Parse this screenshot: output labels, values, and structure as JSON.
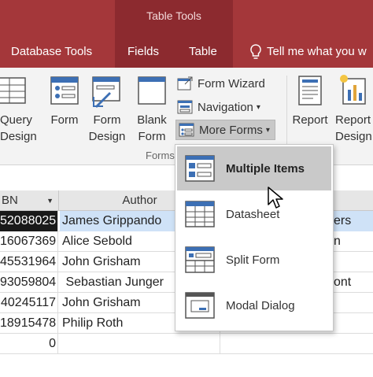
{
  "header": {
    "context_title": "Table Tools",
    "tabs": [
      {
        "label": "Database Tools"
      },
      {
        "label": "Fields"
      },
      {
        "label": "Table"
      }
    ],
    "tell_me": "Tell me what you w"
  },
  "ribbon": {
    "query_design": "Query\nDesign",
    "form": "Form",
    "form_design": "Form\nDesign",
    "blank_form": "Blank\nForm",
    "form_wizard": "Form Wizard",
    "navigation": "Navigation",
    "more_forms": "More Forms",
    "forms_group": "Forms",
    "report": "Report",
    "report_design": "Report\nDesign"
  },
  "table": {
    "columns": [
      {
        "label": "BN"
      },
      {
        "label": "Author"
      }
    ],
    "rows": [
      {
        "isbn": "52088025",
        "author": "James Grippando",
        "extra": "ers"
      },
      {
        "isbn": "16067369",
        "author": "Alice Sebold",
        "extra": "n"
      },
      {
        "isbn": "45531964",
        "author": "John Grisham",
        "extra": ""
      },
      {
        "isbn": "93059804",
        "author": " Sebastian Junger",
        "extra": "ont"
      },
      {
        "isbn": "40245117",
        "author": "John Grisham",
        "extra": ""
      },
      {
        "isbn": "18915478",
        "author": "Philip Roth",
        "extra": ""
      },
      {
        "isbn": "0",
        "author": "",
        "extra": ""
      }
    ]
  },
  "dropdown": {
    "items": [
      {
        "label": "Multiple Items",
        "icon": "multiple-items-icon"
      },
      {
        "label": "Datasheet",
        "icon": "datasheet-icon"
      },
      {
        "label": "Split Form",
        "icon": "split-form-icon"
      },
      {
        "label": "Modal Dialog",
        "icon": "modal-dialog-icon"
      }
    ]
  },
  "colors": {
    "title_bar": "#a4373a",
    "context_band": "#8c2a2f",
    "ribbon_bg": "#f3f3f3",
    "selection": "#cfe2f7",
    "hover": "#c9c9c9"
  }
}
